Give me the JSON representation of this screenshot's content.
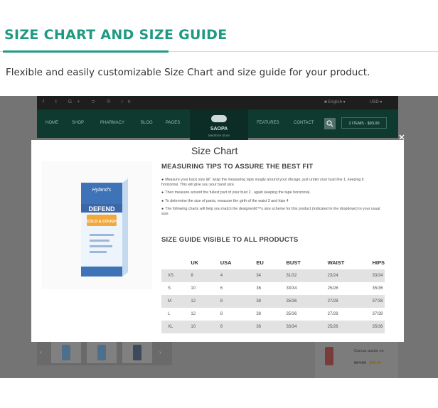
{
  "header": {
    "title": "SIZE CHART AND SIZE GUIDE",
    "subtitle": "Flexible and easily customizable Size Chart and size guide for your product."
  },
  "store": {
    "social_icons": [
      "facebook-icon",
      "twitter-icon",
      "google-plus-icon",
      "rss-icon",
      "pinterest-icon",
      "linkedin-icon"
    ],
    "social_glyphs": "f t G+ ⊃ ® in",
    "language": "English",
    "currency": "USD",
    "nav": [
      "HOME",
      "SHOP",
      "PHARMACY",
      "BLOG",
      "PAGES",
      "FEATURES",
      "CONTACT"
    ],
    "logo": "SAOPA",
    "logo_tagline": "Medicine Store",
    "cart": "2 ITEMS - $93.00",
    "side_product": {
      "name": "Cursus auctor es",
      "old_price": "$64.50",
      "price": "$55.00"
    }
  },
  "modal": {
    "close": "✕",
    "title": "Size Chart",
    "product": {
      "brand": "Hyland's",
      "name": "DEFEND",
      "subtitle": "COLD & COUGH"
    },
    "tips_heading": "MEASURING TIPS TO ASSURE THE BEST FIT",
    "tips": [
      "Measure your back size â€“ wrap the measuring tape snugly around your ribcage, just under your bust line 1, keeping it horizontal. This will give you your band size.",
      "Then measure around the fullest part of your bust 2 , again keeping the tape horizontal.",
      "To determine the size of pants, measure the girth of the waist 3 and hips 4",
      "The following charts will help you match the designerâ€™s size scheme for this product (indicated in the dropdown) to your usual size."
    ],
    "guide_heading": "SIZE GUIDE VISIBLE TO ALL PRODUCTS",
    "table": {
      "headers": [
        "",
        "UK",
        "USA",
        "EU",
        "BUST",
        "WAIST",
        "HIPS"
      ],
      "rows": [
        [
          "XS",
          "8",
          "4",
          "34",
          "31/32",
          "23/24",
          "33/34"
        ],
        [
          "S",
          "10",
          "6",
          "36",
          "33/34",
          "25/26",
          "35/36"
        ],
        [
          "M",
          "12",
          "8",
          "38",
          "35/36",
          "27/28",
          "37/38"
        ],
        [
          "L",
          "12",
          "8",
          "38",
          "35/36",
          "27/28",
          "37/38"
        ],
        [
          "XL",
          "10",
          "6",
          "36",
          "33/34",
          "25/26",
          "35/36"
        ]
      ]
    }
  }
}
